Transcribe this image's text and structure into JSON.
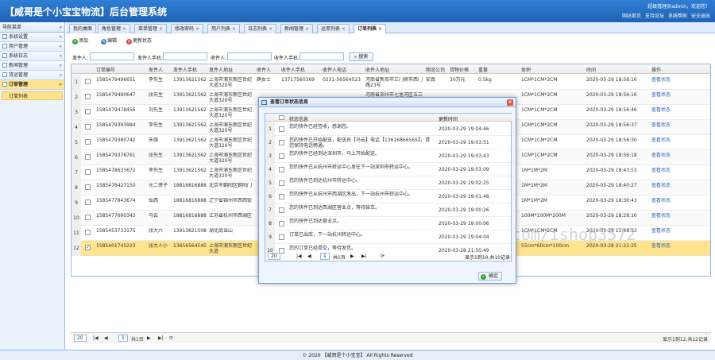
{
  "header": {
    "title": "【威哥是个小宝宝物流】后台管理系统",
    "welcome": "超级管理员admin，欢迎您！",
    "links": [
      "网站首页",
      "支持论坛",
      "系统帮助",
      "安全退出"
    ]
  },
  "sidebar": {
    "title": "导航菜单",
    "collapse": "«",
    "menus": [
      "系统设置",
      "用户管理",
      "系统日志",
      "新闻管理",
      "货运管理",
      "订单管理"
    ],
    "submenu": "订单列表"
  },
  "tabs": [
    "我的桌面",
    "角色管理",
    "菜单管理",
    "修改密码",
    "用户列表",
    "日志列表",
    "新闻管理",
    "运单列表",
    "订单列表"
  ],
  "toolbar": {
    "add": "添加",
    "edit": "编辑",
    "status": "更新状态"
  },
  "search": {
    "l1": "发件人:",
    "l2": "发件人手机:",
    "l3": "收件人:",
    "l4": "收件人手机:",
    "btn": "搜索"
  },
  "grid": {
    "headers": [
      "订单编号",
      "发件人",
      "发件人手机",
      "发件人地址",
      "收件人",
      "收件人手机",
      "收件人电话",
      "收件人地址",
      "物流公司",
      "货物价格",
      "重量",
      "体积",
      "时间",
      "操作"
    ],
    "rows": [
      [
        "1",
        "1585479496651",
        "李先生",
        "13913621562",
        "上海市浦东新区世纪大道320号",
        "薛女士",
        "13717560369",
        "0231-56564523",
        "河南省新郑市三门峡市西门路23号",
        "安真",
        "30万元",
        "0.5kg",
        "1CM*1CM*2CM",
        "2020-03-29 18:58:16",
        "查看状态"
      ],
      [
        "2",
        "1585479490647",
        "张先生",
        "13913621562",
        "上海市浦东新区世纪大道320号",
        "",
        "",
        "",
        "河南省郑州市七里河区五三",
        "",
        "",
        "",
        "1CM*1CM*2CM",
        "2020-03-29 18:56:16",
        "查看状态"
      ],
      [
        "3",
        "1585479478456",
        "刘先生",
        "13913621562",
        "上海市浦东新区世纪大道320号",
        "",
        "",
        "",
        "",
        "",
        "",
        "",
        "1CM*1CM*2CM",
        "2020-03-29 18:56:46",
        "查看状态"
      ],
      [
        "4",
        "1585479393984",
        "李先生",
        "13913621562",
        "上海市浦东新区世纪大道320号",
        "",
        "",
        "",
        "",
        "",
        "",
        "",
        "1CM*1CM*2CM",
        "2020-03-29 18:56:37",
        "查看状态"
      ],
      [
        "5",
        "1585479380742",
        "朱强",
        "13913621562",
        "上海市浦东新区世纪大道320号",
        "",
        "",
        "",
        "",
        "",
        "",
        "",
        "1CM*1CM*2CM",
        "2020-03-29 18:56:30",
        "查看状态"
      ],
      [
        "6",
        "1585479376761",
        "张先生",
        "13913621562",
        "上海市浦东新区世纪大道320号",
        "",
        "",
        "",
        "",
        "",
        "",
        "",
        "1CM*1CM*2CM",
        "2020-03-29 18:56:18",
        "查看状态"
      ],
      [
        "7",
        "1585478633672",
        "李先生",
        "13913621562",
        "上海市浦东新区世纪大道320号",
        "",
        "",
        "",
        "",
        "",
        "",
        "",
        "1M*1M*2M",
        "2020-03-29 18:43:53",
        "查看状态"
      ],
      [
        "8",
        "1585478427150",
        "元二傍子",
        "18816816888",
        "北京市朝阳区朝阳门",
        "",
        "",
        "",
        "",
        "",
        "",
        "",
        "1M*1M*2M",
        "2020-03-29 18:40:27",
        "查看状态"
      ],
      [
        "9",
        "1585477843674",
        "仙西",
        "18816816888",
        "辽宁省锦州市西西街",
        "",
        "",
        "",
        "",
        "",
        "",
        "",
        "1M*1M*2M",
        "2020-03-29 18:30:43",
        "查看状态"
      ],
      [
        "10",
        "1585477690343",
        "马云",
        "18816816888",
        "江苏省杭州市西湖区",
        "",
        "",
        "",
        "",
        "",
        "",
        "",
        "100M*100M*200M",
        "2020-03-29 18:28:10",
        "查看状态"
      ],
      [
        "11",
        "1585453733175",
        "张大六",
        "13913621508",
        "湖北武当山",
        "",
        "",
        "",
        "",
        "",
        "",
        "",
        "1CM*1CM*2CM",
        "2020-03-29 11:48:53",
        "查看状态"
      ],
      [
        "12",
        "1585401745223",
        "张大人小",
        "13656564545",
        "上海市浦东新区世纪大道",
        "",
        "",
        "",
        "",
        "",
        "",
        "",
        "55cm*60cm*100cm",
        "2020-03-28 21:22:25",
        "查看状态"
      ]
    ]
  },
  "pager": {
    "size": "20",
    "page": "1",
    "of": "共1页",
    "summary": "显示1到12,共12记录"
  },
  "dialog": {
    "title": "查看订单状态信息",
    "h1": "状态信息",
    "h2": "更新时间",
    "rows": [
      [
        "1",
        "您的快件已经签收，感谢您。",
        "2020-03-29 19:04:46"
      ],
      [
        "2",
        "您的快件已开始配送，配送员【马云】电话【13616866565】，请您保持电话畅通。",
        "2020-03-29 19:03:51"
      ],
      [
        "3",
        "您的快件已经到达深圳市，马上开始配送。",
        "2020-03-29 19:03:43"
      ],
      [
        "4",
        "您的快件已从杭州市转运中心发往下一站深圳市转运中心。",
        "2020-03-29 19:03:09"
      ],
      [
        "5",
        "您的快件已到达杭州市转运中心。",
        "2020-03-29 19:02:25"
      ],
      [
        "6",
        "您的快件已从杭州市西湖区发出，下一站杭州市转运中心。",
        "2020-03-29 19:01:48"
      ],
      [
        "7",
        "您的快件已到达西湖区营业点，等待装车。",
        "2020-03-29 19:00:26"
      ],
      [
        "8",
        "您的快件已到达营业点。",
        "2020-03-29 19:00:06"
      ],
      [
        "9",
        "订单已出库，下一站杭州转运中心。",
        "2020-03-29 19:04:04"
      ],
      [
        "10",
        "您的订单已经提交，等待发货。",
        "2020-03-28 21:50:49"
      ]
    ],
    "psize": "20",
    "page": "1",
    "of": "共1页",
    "summary": "显示1到10,共10记录",
    "ok": "确定"
  },
  "footer": "© 2020 【威哥是个小宝宝】 All Rights Reserved",
  "watermark": "https://www.huzhan.com/ishop3572"
}
